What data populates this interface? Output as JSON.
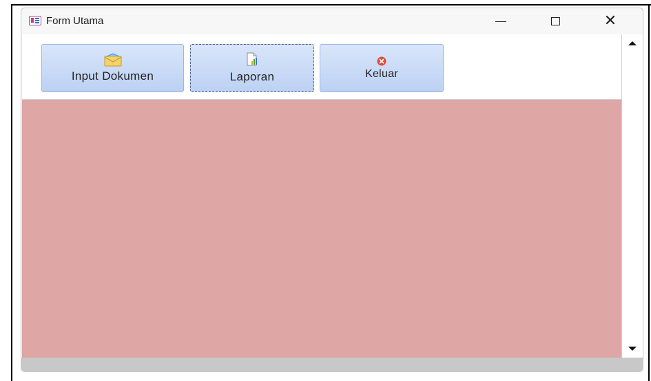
{
  "window": {
    "title": "Form Utama",
    "app_icon": "form-icon",
    "controls": {
      "minimize": "minimize-icon",
      "maximize": "maximize-icon",
      "close_glyph": "✕"
    }
  },
  "toolbar": {
    "buttons": [
      {
        "label": "Input Dokumen",
        "icon": "envelope-icon"
      },
      {
        "label": "Laporan",
        "icon": "report-icon"
      },
      {
        "label": "Keluar",
        "icon": "close-circle-icon"
      }
    ]
  },
  "colors": {
    "detail_background": "#dea6a4",
    "button_gradient_top": "#d9e6fa",
    "button_gradient_bottom": "#bcd1f3",
    "exit_icon": "#e04a3a"
  }
}
